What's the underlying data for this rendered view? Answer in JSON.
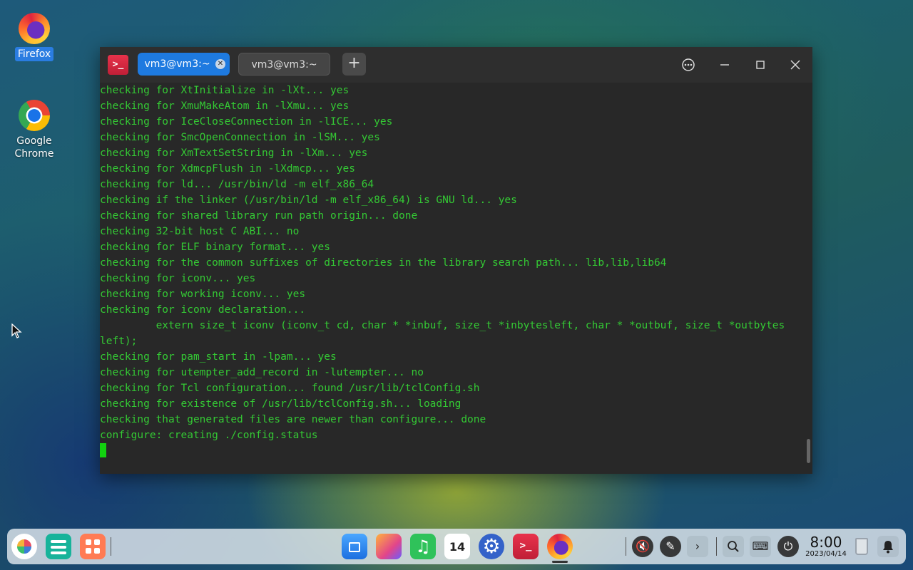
{
  "desktop": {
    "icons": [
      {
        "label": "Firefox"
      },
      {
        "label": "Google\nChrome"
      }
    ]
  },
  "terminal": {
    "tabs": [
      {
        "label": "vm3@vm3:~",
        "active": true
      },
      {
        "label": "vm3@vm3:~",
        "active": false
      }
    ],
    "add_tab_label": "+",
    "lines": [
      "checking for XtInitialize in -lXt... yes",
      "checking for XmuMakeAtom in -lXmu... yes",
      "checking for IceCloseConnection in -lICE... yes",
      "checking for SmcOpenConnection in -lSM... yes",
      "checking for XmTextSetString in -lXm... yes",
      "checking for XdmcpFlush in -lXdmcp... yes",
      "checking for ld... /usr/bin/ld -m elf_x86_64",
      "checking if the linker (/usr/bin/ld -m elf_x86_64) is GNU ld... yes",
      "checking for shared library run path origin... done",
      "checking 32-bit host C ABI... no",
      "checking for ELF binary format... yes",
      "checking for the common suffixes of directories in the library search path... lib,lib,lib64",
      "checking for iconv... yes",
      "checking for working iconv... yes",
      "checking for iconv declaration...",
      "         extern size_t iconv (iconv_t cd, char * *inbuf, size_t *inbytesleft, char * *outbuf, size_t *outbytes",
      "left);",
      "checking for pam_start in -lpam... yes",
      "checking for utempter_add_record in -lutempter... no",
      "checking for Tcl configuration... found /usr/lib/tclConfig.sh",
      "checking for existence of /usr/lib/tclConfig.sh... loading",
      "checking that generated files are newer than configure... done",
      "configure: creating ./config.status"
    ],
    "colors": {
      "text": "#34c934",
      "background": "#282828",
      "accent": "#1e7ae0"
    }
  },
  "taskbar": {
    "calendar_day": "14",
    "clock": {
      "time": "8:00",
      "date": "2023/04/14"
    }
  }
}
